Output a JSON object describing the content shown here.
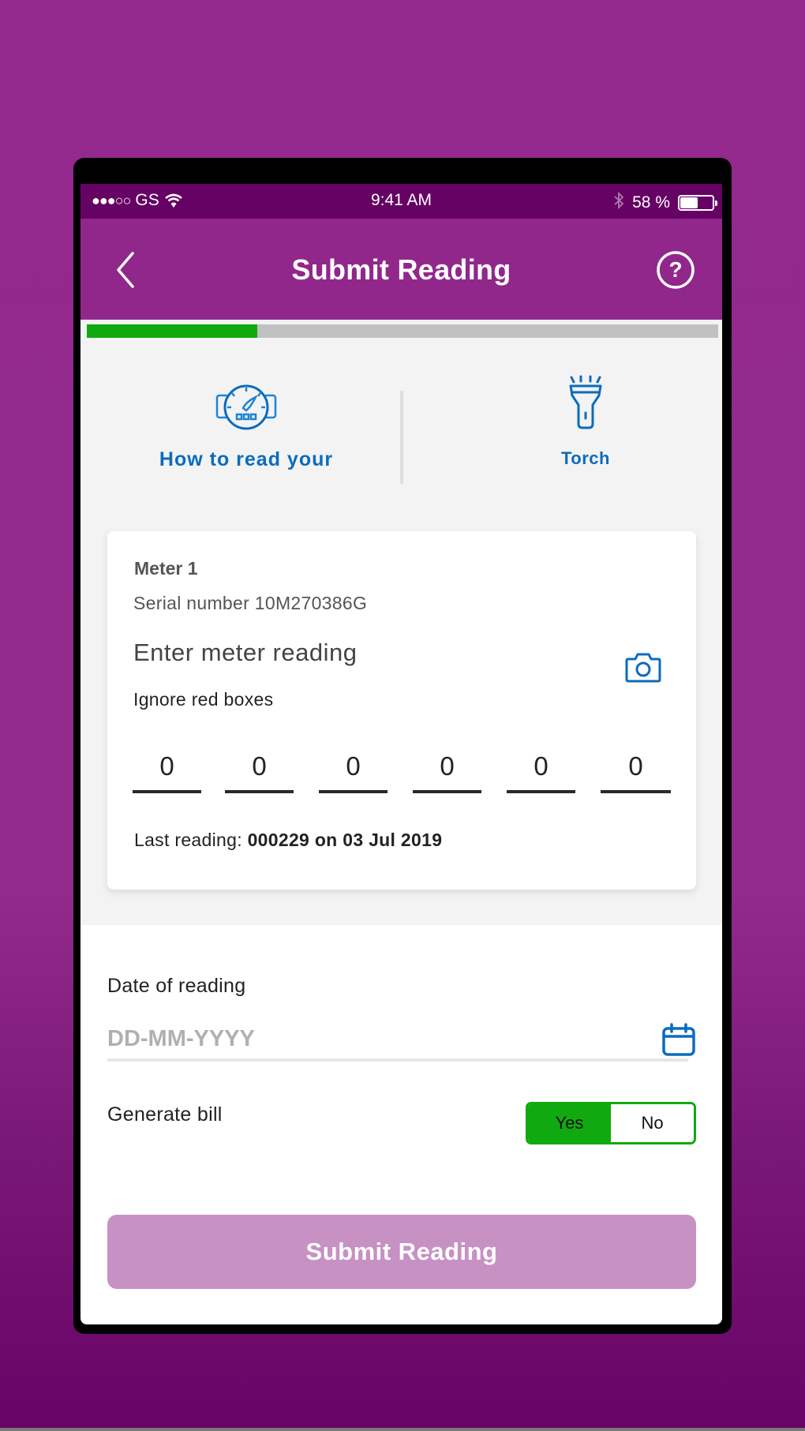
{
  "status_bar": {
    "carrier": "GS",
    "signal": "●●●○○",
    "time": "9:41 AM",
    "battery_text": "58 %",
    "battery_level": 0.58
  },
  "header": {
    "title": "Submit Reading",
    "back_icon": "chevron-left-icon",
    "help_icon": "question-circle-icon"
  },
  "progress": {
    "fraction": 0.27,
    "fill_color": "#10aa10",
    "track_color": "#c1c1c1"
  },
  "shortcuts": [
    {
      "label": "How to read your",
      "icon": "meter-gauge-icon"
    },
    {
      "label": "Torch",
      "icon": "torch-icon"
    }
  ],
  "meter_card": {
    "title": "Meter 1",
    "serial": "Serial number 10M270386G",
    "enter_label": "Enter meter reading",
    "hint": "Ignore red boxes",
    "camera_icon": "camera-icon",
    "digits": [
      "0",
      "0",
      "0",
      "0",
      "0",
      "0"
    ],
    "last_reading_label": "Last reading:",
    "last_reading_value": "000229 on 03 Jul 2019"
  },
  "date": {
    "label": "Date of reading",
    "placeholder": "DD-MM-YYYY",
    "value": "",
    "icon": "calendar-icon"
  },
  "generate_bill": {
    "label": "Generate bill",
    "options": [
      "Yes",
      "No"
    ],
    "selected": "Yes"
  },
  "submit": {
    "label": "Submit Reading"
  },
  "colors": {
    "brand_purple": "#91278b",
    "status_purple": "#650264",
    "accent_blue": "#0b6cbd",
    "success_green": "#10aa10",
    "disabled_button": "#c791c4"
  }
}
